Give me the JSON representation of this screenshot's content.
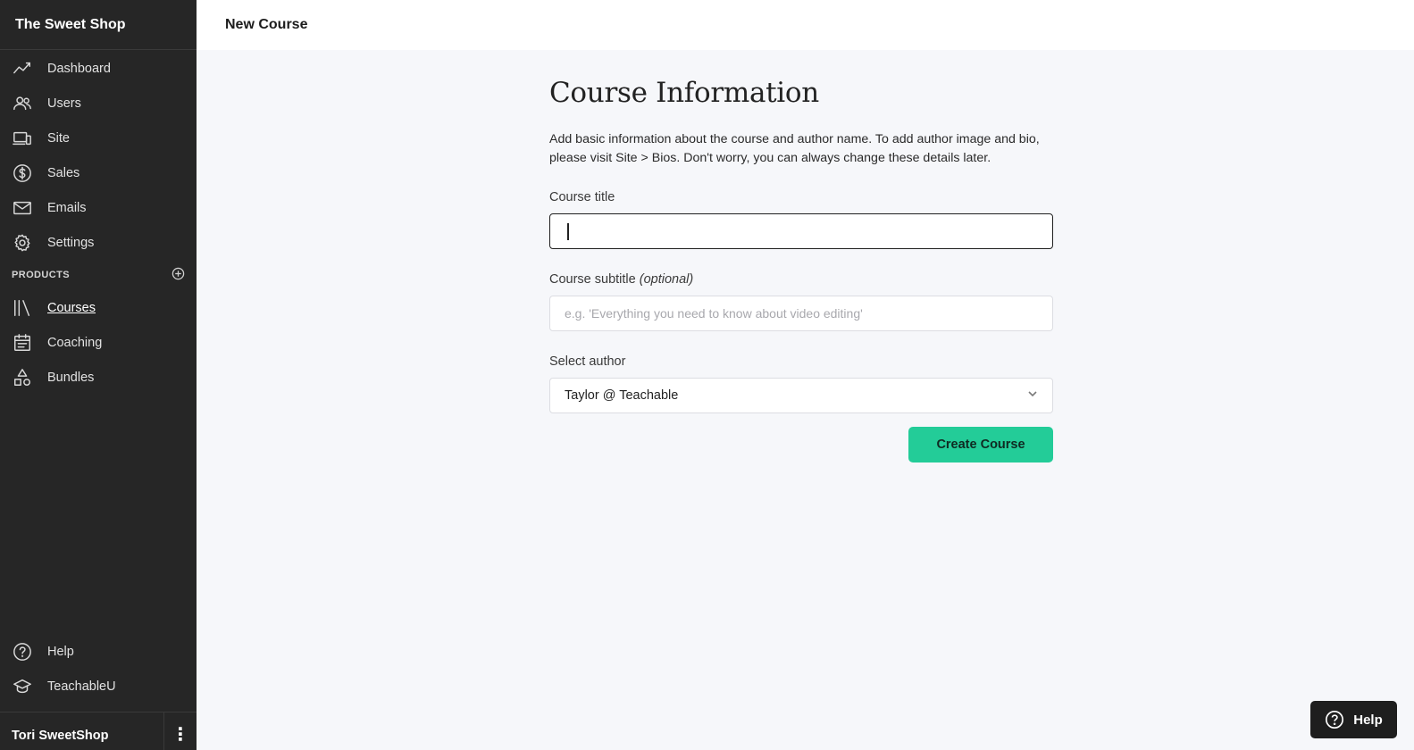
{
  "sidebar": {
    "brand": "The Sweet Shop",
    "items": [
      {
        "label": "Dashboard",
        "icon": "dashboard-chart-icon"
      },
      {
        "label": "Users",
        "icon": "users-icon"
      },
      {
        "label": "Site",
        "icon": "site-devices-icon"
      },
      {
        "label": "Sales",
        "icon": "dollar-icon"
      },
      {
        "label": "Emails",
        "icon": "mail-icon"
      },
      {
        "label": "Settings",
        "icon": "gear-icon"
      }
    ],
    "products_header": "PRODUCTS",
    "products": [
      {
        "label": "Courses",
        "icon": "books-icon",
        "active": true
      },
      {
        "label": "Coaching",
        "icon": "calendar-icon"
      },
      {
        "label": "Bundles",
        "icon": "shapes-icon"
      }
    ],
    "bottom": [
      {
        "label": "Help",
        "icon": "help-circle-icon"
      },
      {
        "label": "TeachableU",
        "icon": "graduation-cap-icon"
      }
    ],
    "user_name": "Tori SweetShop"
  },
  "header": {
    "title": "New Course"
  },
  "form": {
    "heading": "Course Information",
    "description": "Add basic information about the course and author name. To add author image and bio, please visit Site > Bios. Don't worry, you can always change these details later.",
    "title_label": "Course title",
    "title_value": "",
    "subtitle_label": "Course subtitle",
    "subtitle_optional": "(optional)",
    "subtitle_placeholder": "e.g. 'Everything you need to know about video editing'",
    "author_label": "Select author",
    "author_value": "Taylor @ Teachable",
    "submit_label": "Create Course"
  },
  "help_button": {
    "label": "Help"
  },
  "colors": {
    "sidebar_bg": "#262626",
    "accent": "#23cc98",
    "page_bg": "#f6f7fa"
  }
}
